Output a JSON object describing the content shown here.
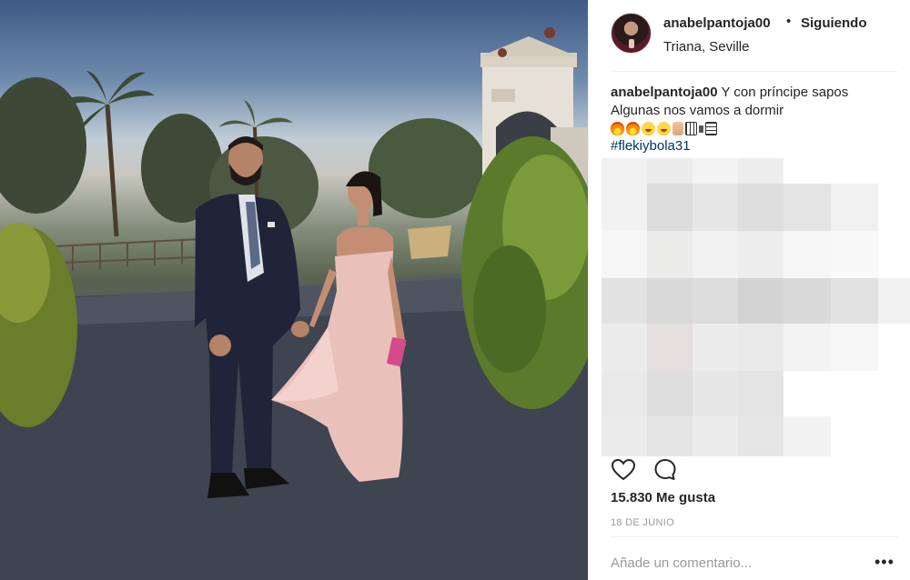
{
  "post": {
    "username": "anabelpantoja00",
    "separator": "•",
    "follow_status": "Siguiendo",
    "location": "Triana, Seville"
  },
  "caption": {
    "username": "anabelpantoja00",
    "line1": "Y con príncipe sapos",
    "line2": "Algunas nos vamos a dormir",
    "emojis": [
      "fire",
      "fire",
      "grinning-face",
      "grinning-face",
      "victory-hand",
      "unknown-glyph",
      "unknown-glyph"
    ],
    "hashtag": "#flekiybola31"
  },
  "comments_blurred": true,
  "actions": {
    "like_icon": "heart-icon",
    "comment_icon": "comment-icon"
  },
  "likes": "15.830 Me gusta",
  "date": "18 DE JUNIO",
  "comment_box": {
    "placeholder": "Añade un comentario...",
    "more_label": "•••"
  },
  "colors": {
    "text": "#262626",
    "muted": "#999999",
    "hashtag": "#003569",
    "divider": "#efefef"
  }
}
